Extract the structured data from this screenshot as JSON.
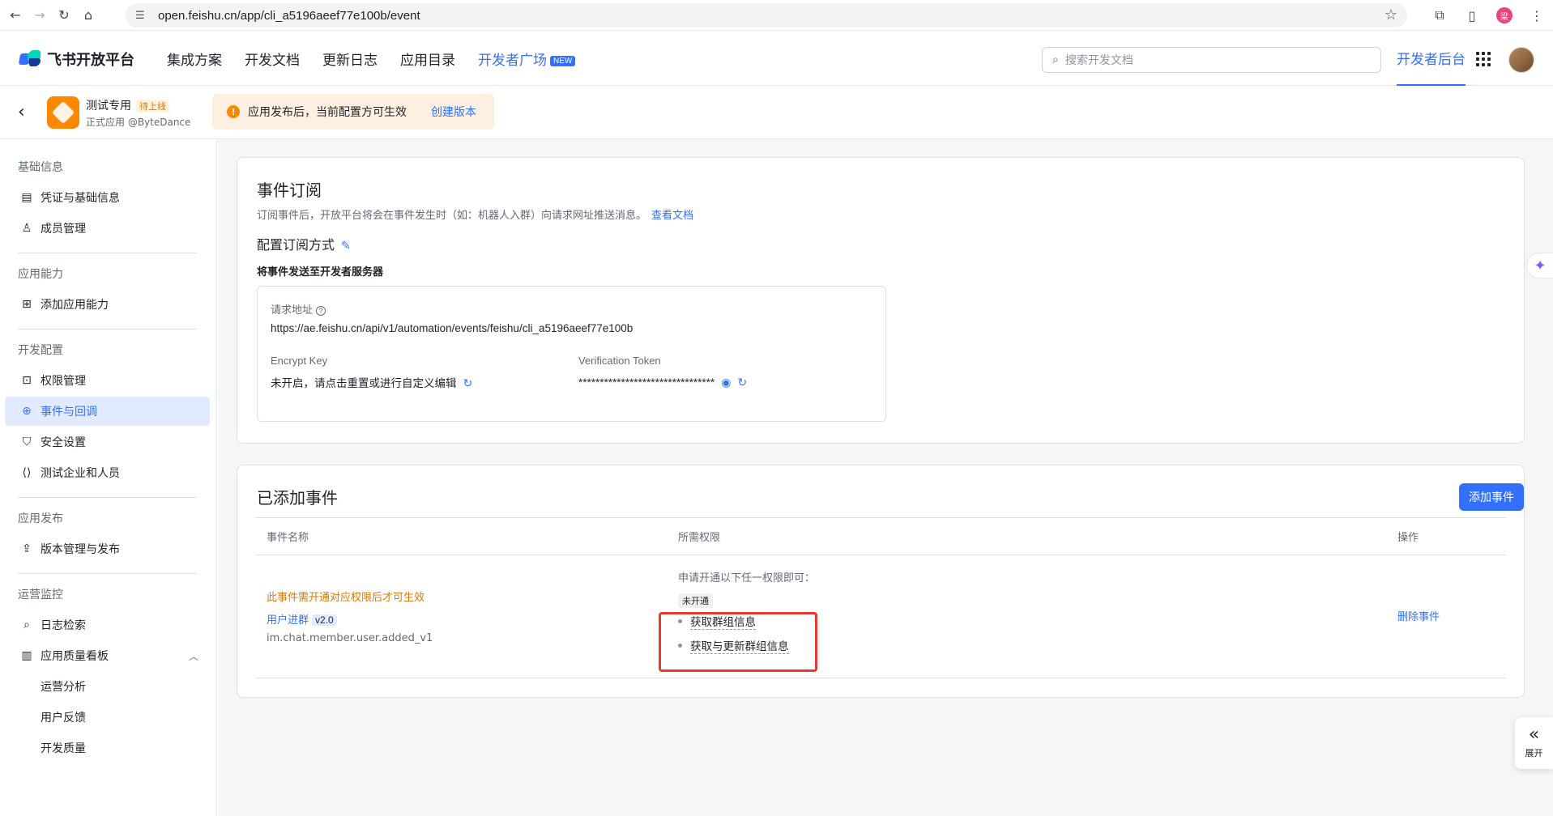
{
  "browser": {
    "url": "open.feishu.cn/app/cli_a5196aeef77e100b/event",
    "profile_initial": "梁"
  },
  "topnav": {
    "logo_text": "飞书开放平台",
    "links": [
      "集成方案",
      "开发文档",
      "更新日志",
      "应用目录"
    ],
    "dev_plaza": "开发者广场",
    "new_badge": "NEW",
    "search_placeholder": "搜索开发文档",
    "dev_console": "开发者后台"
  },
  "app": {
    "name": "测试专用",
    "status": "待上线",
    "subtitle": "正式应用 @ByteDance",
    "notice_text": "应用发布后，当前配置方可生效",
    "notice_link": "创建版本"
  },
  "sidebar": {
    "groups": [
      "基础信息",
      "应用能力",
      "开发配置",
      "应用发布",
      "运营监控"
    ],
    "items": [
      {
        "label": "凭证与基础信息",
        "icon": "credential-icon"
      },
      {
        "label": "成员管理",
        "icon": "member-icon"
      },
      {
        "label": "添加应用能力",
        "icon": "capability-icon"
      },
      {
        "label": "权限管理",
        "icon": "permission-icon"
      },
      {
        "label": "事件与回调",
        "icon": "event-icon"
      },
      {
        "label": "安全设置",
        "icon": "shield-icon"
      },
      {
        "label": "测试企业和人员",
        "icon": "code-icon"
      },
      {
        "label": "版本管理与发布",
        "icon": "release-icon"
      },
      {
        "label": "日志检索",
        "icon": "log-search-icon"
      },
      {
        "label": "应用质量看板",
        "icon": "chart-icon"
      },
      {
        "label": "运营分析",
        "icon": ""
      },
      {
        "label": "用户反馈",
        "icon": ""
      },
      {
        "label": "开发质量",
        "icon": ""
      }
    ]
  },
  "event_sub": {
    "title": "事件订阅",
    "desc": "订阅事件后，开放平台将会在事件发生时（如：机器人入群）向请求网址推送消息。",
    "doc_link": "查看文档",
    "config_title": "配置订阅方式",
    "send_to": "将事件发送至开发者服务器",
    "request_url_label": "请求地址",
    "request_url": "https://ae.feishu.cn/api/v1/automation/events/feishu/cli_a5196aeef77e100b",
    "encrypt_label": "Encrypt Key",
    "encrypt_value": "未开启，请点击重置或进行自定义编辑",
    "token_label": "Verification Token",
    "token_value": "********************************"
  },
  "added_events": {
    "title": "已添加事件",
    "add_button": "添加事件",
    "columns": [
      "事件名称",
      "所需权限",
      "操作"
    ],
    "row": {
      "warning": "此事件需开通对应权限后才可生效",
      "event_name": "用户进群",
      "version": "v2.0",
      "event_key": "im.chat.member.user.added_v1",
      "perm_hint": "申请开通以下任一权限即可：",
      "perm_status": "未开通",
      "perms": [
        "获取群组信息",
        "获取与更新群组信息"
      ],
      "action": "删除事件"
    }
  },
  "float": {
    "expand_label": "展开"
  }
}
